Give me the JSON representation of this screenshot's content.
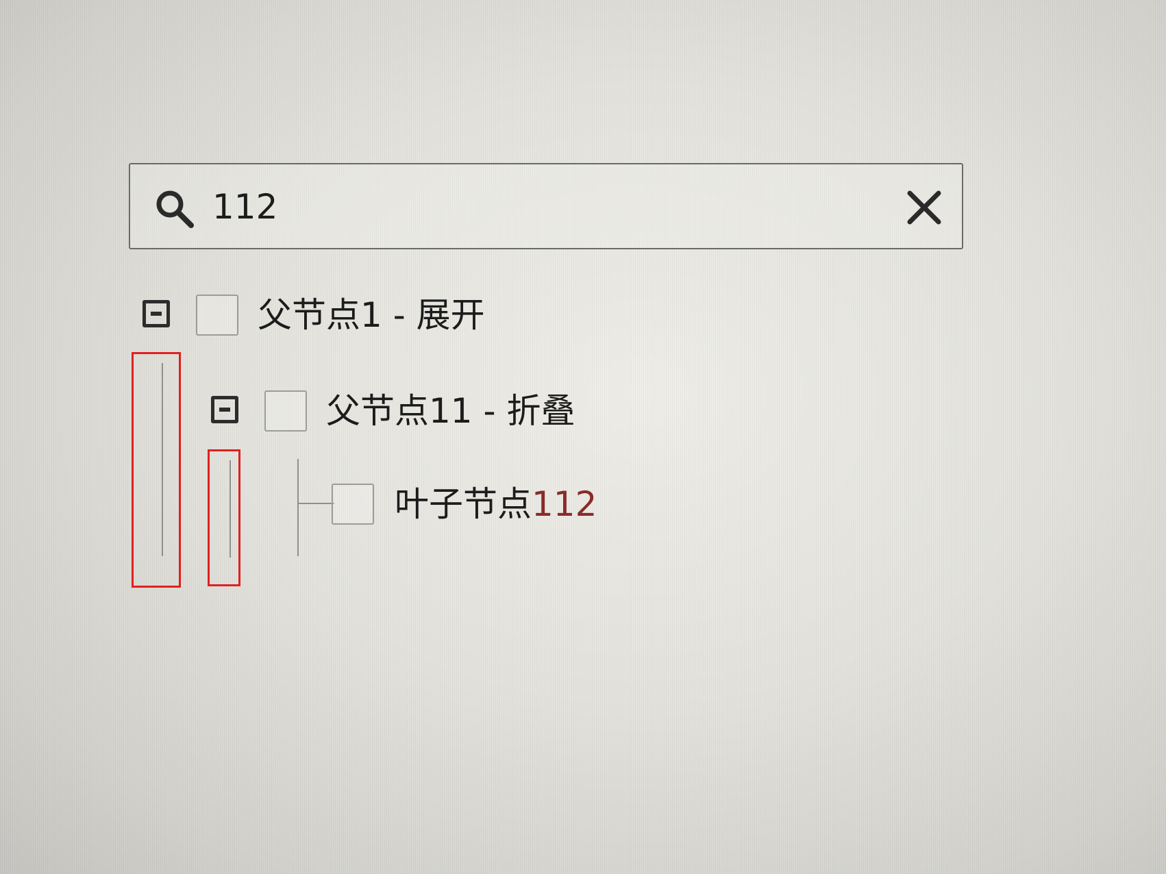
{
  "search": {
    "value": "112",
    "icon": "search-icon",
    "clear_icon": "close-icon"
  },
  "tree": {
    "nodes": [
      {
        "prefix": "父节点1 - 展开",
        "highlight": "",
        "toggle_icon": "collapse-minus-icon"
      },
      {
        "prefix": "父节点11 - 折叠",
        "highlight": "",
        "toggle_icon": "collapse-minus-icon"
      },
      {
        "prefix": "叶子节点",
        "highlight": "112"
      }
    ]
  },
  "colors": {
    "highlight": "#8a2a2a",
    "annotation": "#e02020"
  }
}
